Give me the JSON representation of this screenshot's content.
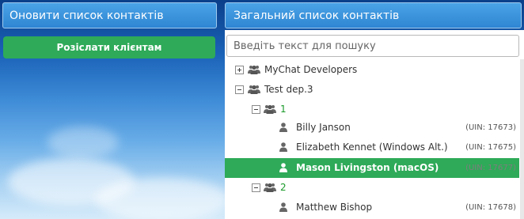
{
  "left_panel": {
    "header_title": "Оновити список контактів",
    "send_button_label": "Розіслати клієнтам"
  },
  "right_panel": {
    "header_title": "Загальний список контактів",
    "search": {
      "placeholder": "Введіть текст для пошуку",
      "value": ""
    }
  },
  "tree": {
    "groups": [
      {
        "label": "MyChat Developers",
        "expanded": false,
        "icon": "group-icon"
      },
      {
        "label": "Test dep.3",
        "expanded": true,
        "icon": "group-icon"
      }
    ],
    "subgroups": [
      {
        "label": "1",
        "expanded": true,
        "icon": "group-icon"
      },
      {
        "label": "2",
        "expanded": true,
        "icon": "group-icon"
      }
    ],
    "users": [
      {
        "name": "Billy Janson",
        "uin": "(UIN: 17673)",
        "selected": false,
        "icon": "user-icon"
      },
      {
        "name": "Elizabeth Kennet (Windows Alt.)",
        "uin": "(UIN: 17675)",
        "selected": false,
        "icon": "user-icon"
      },
      {
        "name": "Mason Livingston (macOS)",
        "uin": "(UIN: 17677)",
        "selected": true,
        "icon": "user-icon"
      },
      {
        "name": "Matthew Bishop",
        "uin": "(UIN: 17678)",
        "selected": false,
        "icon": "user-icon"
      }
    ]
  },
  "colors": {
    "header_blue": "#2f86d3",
    "accent_green": "#2eaa58",
    "subgroup_green": "#1a9a2a"
  }
}
